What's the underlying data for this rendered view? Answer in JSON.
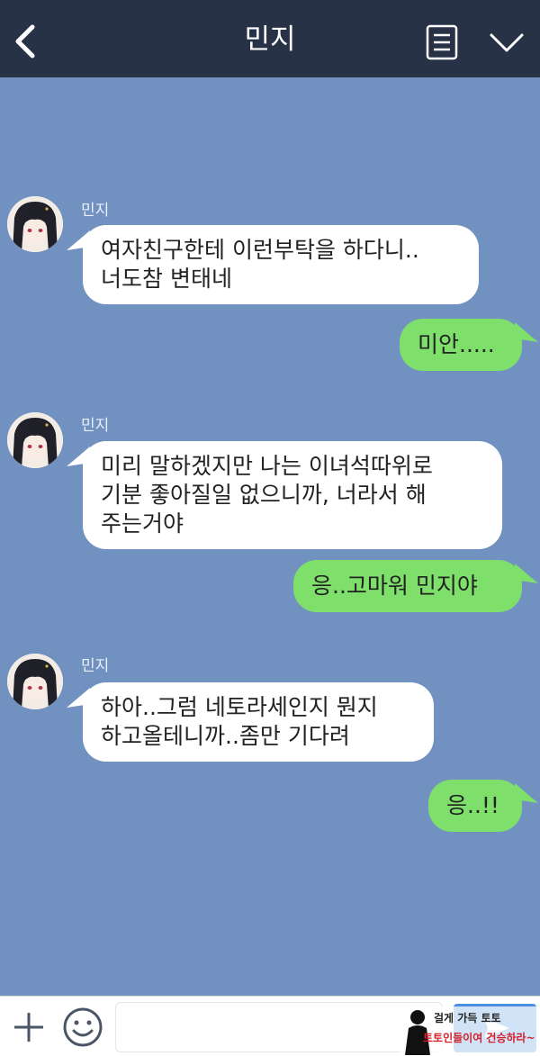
{
  "header": {
    "title": "민지",
    "back_icon": "chevron-left-icon",
    "menu_icon": "list-icon",
    "expand_icon": "chevron-down-icon"
  },
  "messages": [
    {
      "direction": "in",
      "sender": "민지",
      "text": "여자친구한테 이런부탁을 하다니..\n너도참 변태네"
    },
    {
      "direction": "out",
      "text": "미안....."
    },
    {
      "direction": "in",
      "sender": "민지",
      "text": "미리 말하겠지만 나는 이녀석따위로\n기분 좋아질일 없으니까, 너라서 해\n주는거야"
    },
    {
      "direction": "out",
      "text": "응..고마워 민지야"
    },
    {
      "direction": "in",
      "sender": "민지",
      "text": "하아..그럼 네토라세인지 뭔지\n하고올테니까..좀만 기다려"
    },
    {
      "direction": "out",
      "text": "응..!!"
    }
  ],
  "input_bar": {
    "plus_icon": "plus-icon",
    "emoji_icon": "emoji-icon",
    "message_value": "",
    "send_icon": "send-icon"
  },
  "watermark": {
    "line1": "걸게 가득 토토",
    "line2": "토토인들이여 건승하라~"
  },
  "colors": {
    "background": "#7191c0",
    "header": "#283247",
    "incoming_bubble": "#ffffff",
    "outgoing_bubble": "#7ee06a"
  }
}
